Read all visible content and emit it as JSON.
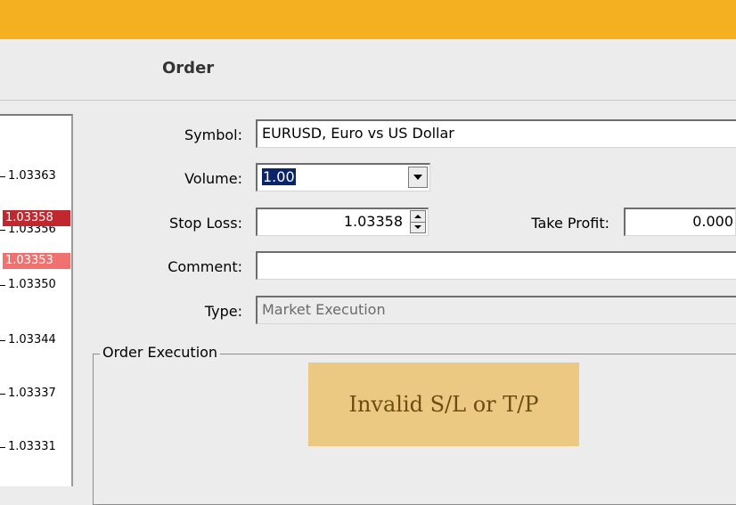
{
  "window": {
    "title": "Order"
  },
  "price_scale": {
    "ticks": [
      "1.03363",
      "1.03356",
      "1.03350",
      "1.03344",
      "1.03337",
      "1.03331"
    ],
    "ask_tag": {
      "value": "1.03358",
      "color": "#c0282f"
    },
    "bid_tag": {
      "value": "1.03353",
      "color": "#f07270"
    }
  },
  "form": {
    "symbol": {
      "label": "Symbol:",
      "value": "EURUSD, Euro vs US Dollar"
    },
    "volume": {
      "label": "Volume:",
      "value": "1.00"
    },
    "stop_loss": {
      "label": "Stop Loss:",
      "value": "1.03358"
    },
    "take_profit": {
      "label": "Take Profit:",
      "value": "0.000"
    },
    "comment": {
      "label": "Comment:",
      "value": ""
    },
    "type": {
      "label": "Type:",
      "value": "Market Execution"
    }
  },
  "order_execution": {
    "legend": "Order Execution",
    "error_message": "Invalid S/L or T/P"
  },
  "colors": {
    "top_bar": "#f5b021",
    "error_bg": "#ebc982",
    "error_text": "#6b4d12"
  },
  "icons": {
    "volume_dropdown": "triangle-down",
    "stop_loss_spinner": "up-down-arrows"
  }
}
